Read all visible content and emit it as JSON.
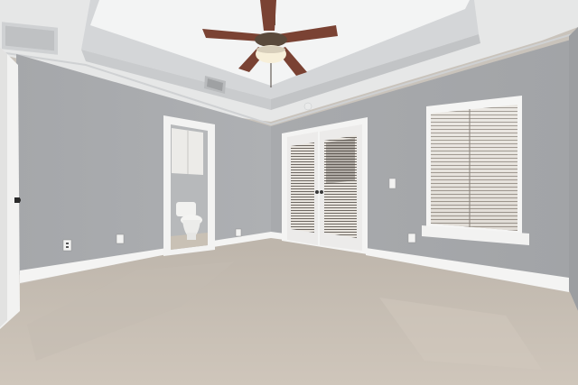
{
  "scene": {
    "subject": "empty-bedroom",
    "colors": {
      "wall": "#a7a9ac",
      "wall_right": "#a9abae",
      "ceiling": "#eeefef",
      "tray_ceiling": "#f4f5f5",
      "trim": "#f5f5f4",
      "carpet": "#c8bfb4",
      "fan_blade": "#7a4233",
      "fan_bronze": "#5a4a3c",
      "window_blind": "#ece9e4",
      "glass_dark": "#4a4440"
    },
    "objects": [
      "ceiling-fan",
      "tray-ceiling",
      "hvac-vent",
      "entry-door",
      "bathroom-doorway",
      "toilet",
      "french-doors",
      "window-with-blinds",
      "electrical-outlet",
      "light-switch",
      "baseboards",
      "carpet-floor"
    ]
  }
}
